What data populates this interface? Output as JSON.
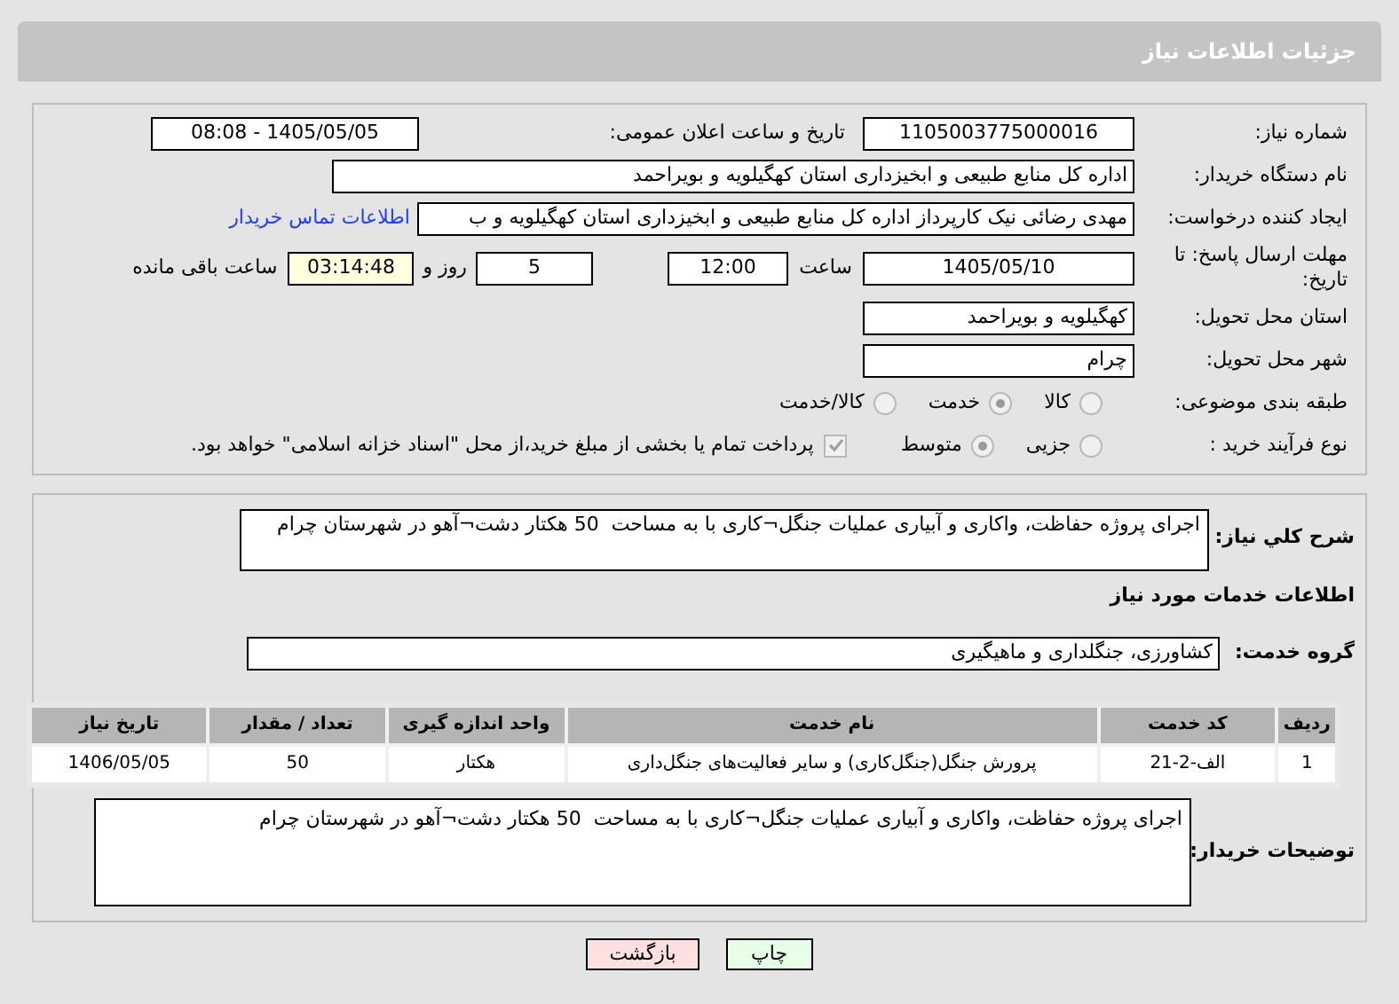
{
  "header": {
    "title": "جزئیات اطلاعات نیاز"
  },
  "need_number": {
    "label": "شماره نیاز:",
    "value": "1105003775000016"
  },
  "announce": {
    "label": "تاریخ و ساعت اعلان عمومی:",
    "value": "1405/05/05 - 08:08"
  },
  "buyer_org": {
    "label": "نام دستگاه خریدار:",
    "value": "اداره کل منابع طبیعی و ابخیزداری استان کهگیلویه و بویراحمد"
  },
  "requester": {
    "label": "ایجاد کننده درخواست:",
    "value": "مهدی رضائی نیک کارپرداز اداره کل منابع طبیعی و ابخیزداری استان کهگیلویه و ب",
    "link": "اطلاعات تماس خریدار"
  },
  "deadline": {
    "label": "مهلت ارسال پاسخ: تا تاریخ:",
    "date": "1405/05/10",
    "time_label": "ساعت",
    "time": "12:00",
    "days": "5",
    "days_label": "روز و",
    "remaining": "03:14:48",
    "remaining_label": "ساعت باقی مانده"
  },
  "province": {
    "label": "استان محل تحویل:",
    "value": "کهگیلویه و بویراحمد"
  },
  "city": {
    "label": "شهر محل تحویل:",
    "value": "چرام"
  },
  "category": {
    "label": "طبقه بندی موضوعی:",
    "options": [
      {
        "label": "کالا",
        "selected": false
      },
      {
        "label": "خدمت",
        "selected": true
      },
      {
        "label": "کالا/خدمت",
        "selected": false
      }
    ]
  },
  "process": {
    "label": "نوع فرآیند خرید :",
    "options": [
      {
        "label": "جزیی",
        "selected": false
      },
      {
        "label": "متوسط",
        "selected": true
      }
    ],
    "payment": {
      "checked": true,
      "text": "پرداخت تمام یا بخشی از مبلغ خرید،از محل \"اسناد خزانه اسلامی\" خواهد بود."
    }
  },
  "summary": {
    "label": "شرح کلي نياز:",
    "value": "اجرای پروژه حفاظت، واکاری و آبیاری عملیات جنگل¬کاری با به مساحت  50 هکتار دشت¬آهو در شهرستان چرام"
  },
  "services_heading": "اطلاعات خدمات مورد نیاز",
  "service_group": {
    "label": "گروه خدمت:",
    "value": "کشاورزی، جنگلداری و ماهیگیری"
  },
  "table": {
    "columns": [
      "ردیف",
      "کد خدمت",
      "نام خدمت",
      "واحد اندازه گیری",
      "تعداد / مقدار",
      "تاریخ نیاز"
    ],
    "rows": [
      [
        "1",
        "الف-2-21",
        "پرورش جنگل(جنگل‌کاری) و سایر فعالیت‌های جنگل‌داری",
        "هکتار",
        "50",
        "1406/05/05"
      ]
    ]
  },
  "buyer_notes": {
    "label": "توضیحات خریدار:",
    "value": "اجرای پروژه حفاظت، واکاری و آبیاری عملیات جنگل¬کاری با به مساحت  50 هکتار دشت¬آهو در شهرستان چرام"
  },
  "buttons": [
    {
      "label": "چاپ",
      "kind": "print"
    },
    {
      "label": "بازگشت",
      "kind": "back"
    }
  ]
}
